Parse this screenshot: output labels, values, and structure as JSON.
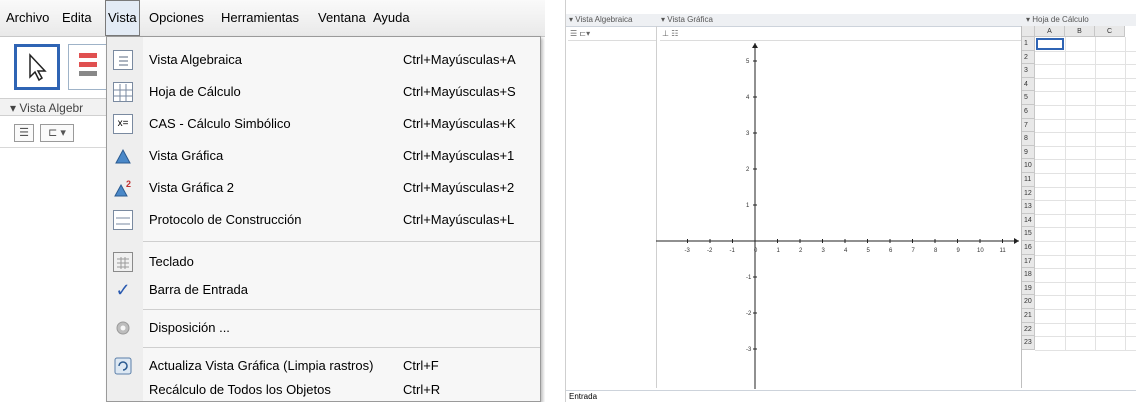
{
  "menubar": {
    "items": [
      "Archivo",
      "Edita",
      "Vista",
      "Opciones",
      "Herramientas",
      "Ventana",
      "Ayuda"
    ],
    "active": "Vista"
  },
  "left_panel": {
    "algebra_header": "Vista Algebr"
  },
  "vista_menu": {
    "items": [
      {
        "label": "Vista Algebraica",
        "shortcut": "Ctrl+Mayúsculas+A",
        "icon": "algebra-view-icon"
      },
      {
        "label": "Hoja de Cálculo",
        "shortcut": "Ctrl+Mayúsculas+S",
        "icon": "spreadsheet-view-icon"
      },
      {
        "label": "CAS - Cálculo Simbólico",
        "shortcut": "Ctrl+Mayúsculas+K",
        "icon": "cas-view-icon"
      },
      {
        "label": "Vista Gráfica",
        "shortcut": "Ctrl+Mayúsculas+1",
        "icon": "graphics-view-icon"
      },
      {
        "label": "Vista Gráfica 2",
        "shortcut": "Ctrl+Mayúsculas+2",
        "icon": "graphics-view-2-icon"
      },
      {
        "label": "Protocolo de Construcción",
        "shortcut": "Ctrl+Mayúsculas+L",
        "icon": "construction-protocol-icon"
      },
      {
        "label": "Teclado",
        "shortcut": "",
        "icon": "keyboard-icon"
      },
      {
        "label": "Barra de Entrada",
        "shortcut": "",
        "icon": "checkmark-icon"
      },
      {
        "label": "Disposición ...",
        "shortcut": "",
        "icon": "layout-gear-icon"
      },
      {
        "label": "Actualiza Vista Gráfica (Limpia rastros)",
        "shortcut": "Ctrl+F",
        "icon": "refresh-icon"
      },
      {
        "label": "Recálculo de Todos los Objetos",
        "shortcut": "Ctrl+R",
        "icon": ""
      }
    ]
  },
  "right_app": {
    "algebra_header": "Vista Algebraica",
    "graphics_header": "Vista Gráfica",
    "sheet_header": "Hoja de Cálculo",
    "columns": [
      "A",
      "B",
      "C"
    ],
    "rows": [
      "1",
      "2",
      "3",
      "4",
      "5",
      "6",
      "7",
      "8",
      "9",
      "10",
      "11",
      "12",
      "13",
      "14",
      "15",
      "16",
      "17",
      "18",
      "19",
      "20",
      "21",
      "22",
      "23"
    ],
    "x_ticks": [
      "-3",
      "-2",
      "-1",
      "0",
      "1",
      "2",
      "3",
      "4",
      "5",
      "6",
      "7",
      "8",
      "9",
      "10",
      "11"
    ],
    "y_ticks": [
      "5",
      "4",
      "3",
      "2",
      "1",
      "0",
      "-1",
      "-2",
      "-3"
    ],
    "input_label": "Entrada"
  }
}
